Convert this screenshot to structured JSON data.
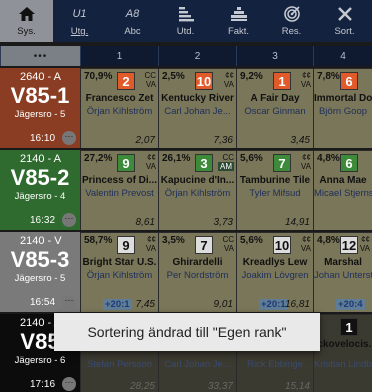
{
  "toolbar": [
    {
      "id": "sys",
      "label": "Sys.",
      "icon": "home-icon",
      "state": "active"
    },
    {
      "id": "utg",
      "label": "Utg.",
      "icon_text": "U1",
      "state": "selected"
    },
    {
      "id": "abc",
      "label": "Abc",
      "icon_text": "A8",
      "state": "normal"
    },
    {
      "id": "utd",
      "label": "Utd.",
      "icon": "bar-sort-icon",
      "state": "normal"
    },
    {
      "id": "fakt",
      "label": "Fakt.",
      "icon": "stack-bars-icon",
      "state": "normal"
    },
    {
      "id": "res",
      "label": "Res.",
      "icon": "target-icon",
      "state": "normal"
    },
    {
      "id": "sort",
      "label": "Sort.",
      "icon": "close-icon",
      "state": "normal"
    }
  ],
  "column_header": {
    "dots": "•••",
    "cols": [
      "1",
      "2",
      "3",
      "4"
    ]
  },
  "races": [
    {
      "top": "2640 - A",
      "name": "V85-1",
      "track": "Jägersro - 5",
      "time": "16:10",
      "color": "#8a3d22",
      "horses": [
        {
          "pct": "70,9%",
          "num": "2",
          "num_bg": "#e05a2a",
          "num_fg": "#fff",
          "tag1": "CC",
          "tag2": "VA",
          "name": "Francesco Zet",
          "driver": "Örjan Kihlström",
          "val": "2,07"
        },
        {
          "pct": "2,5%",
          "num": "10",
          "num_bg": "#e05a2a",
          "num_fg": "#fff",
          "tag1": "¢¢",
          "tag2": "VA",
          "name": "Kentucky River",
          "driver": "Carl Johan Je...",
          "val": "7,36"
        },
        {
          "pct": "9,2%",
          "num": "1",
          "num_bg": "#e05a2a",
          "num_fg": "#fff",
          "tag1": "¢¢",
          "tag2": "VA",
          "name": "A Fair Day",
          "driver": "Oscar Ginman",
          "val": "3,45"
        },
        {
          "pct": "7,8%",
          "num": "6",
          "num_bg": "#e05a2a",
          "num_fg": "#fff",
          "tag1": "",
          "tag2": "",
          "name": "Immortal Do",
          "driver": "Björn Goop",
          "val": ""
        }
      ]
    },
    {
      "top": "2140 - A",
      "name": "V85-2",
      "track": "Jägersro - 4",
      "time": "16:32",
      "color": "#2f6b2e",
      "horses": [
        {
          "pct": "27,2%",
          "num": "9",
          "num_bg": "#3d8a3a",
          "num_fg": "#fff",
          "tag1": "¢¢",
          "tag2": "VA",
          "name": "Princess of Di...",
          "driver": "Valentin Prevost",
          "val": "8,61"
        },
        {
          "pct": "26,1%",
          "num": "3",
          "num_bg": "#3d8a3a",
          "num_fg": "#fff",
          "tag1": "CC",
          "tag2": "AM",
          "name": "Kapucine d'In...",
          "driver": "Örjan Kihlström",
          "val": "3,73"
        },
        {
          "pct": "5,6%",
          "num": "7",
          "num_bg": "#3d8a3a",
          "num_fg": "#fff",
          "tag1": "¢¢",
          "tag2": "VA",
          "name": "Tamburine Tile",
          "driver": "Tyler Mifsud",
          "val": "14,91"
        },
        {
          "pct": "4,8%",
          "num": "6",
          "num_bg": "#3d8a3a",
          "num_fg": "#fff",
          "tag1": "",
          "tag2": "",
          "name": "Anna Mae",
          "driver": "Micael Stjernst",
          "val": ""
        }
      ]
    },
    {
      "top": "2140 - V",
      "name": "V85-3",
      "track": "Jägersro - 5",
      "time": "16:54",
      "color": "#7a7a7a",
      "horses": [
        {
          "pct": "58,7%",
          "num": "9",
          "num_bg": "#ddd",
          "num_fg": "#111",
          "tag1": "¢¢",
          "tag2": "VA",
          "name": "Bright Star U.S.",
          "driver": "Örjan Kihlström",
          "val": "7,45",
          "bonus": "+20:1"
        },
        {
          "pct": "3,5%",
          "num": "7",
          "num_bg": "#ddd",
          "num_fg": "#111",
          "tag1": "CC",
          "tag2": "VA",
          "name": "Ghirardelli",
          "driver": "Per Nordström",
          "val": "9,01"
        },
        {
          "pct": "5,6%",
          "num": "10",
          "num_bg": "#ddd",
          "num_fg": "#111",
          "tag1": "¢¢",
          "tag2": "VA",
          "name": "Kreadlys Lew",
          "driver": "Joakim Lövgren",
          "val": "16,81",
          "bonus": "+20:1"
        },
        {
          "pct": "4,8%",
          "num": "12",
          "num_bg": "#ddd",
          "num_fg": "#111",
          "tag1": "¢¢",
          "tag2": "VA",
          "name": "Marshal",
          "driver": "Johan Untersteir",
          "val": "",
          "bonus": "+20:4"
        }
      ]
    },
    {
      "top": "2140 - A",
      "name": "V85",
      "track": "Jägersro - 6",
      "time": "17:16",
      "color": "#0c0c0c",
      "horses": [
        {
          "pct": "",
          "num": "",
          "num_bg": "",
          "num_fg": "",
          "tag1": "",
          "tag2": "",
          "name": "",
          "driver": "Stefan Persson",
          "val": "28,25"
        },
        {
          "pct": "",
          "num": "",
          "num_bg": "",
          "num_fg": "",
          "tag1": "",
          "tag2": "",
          "name": "",
          "driver": "Carl Johan Je...",
          "val": "33,37"
        },
        {
          "pct": "",
          "num": "",
          "num_bg": "",
          "num_fg": "",
          "tag1": "",
          "tag2": "",
          "name": "",
          "driver": "Rick Ebbinge",
          "val": "15,14"
        },
        {
          "pct": "",
          "num": "1",
          "num_bg": "#111",
          "num_fg": "#fff",
          "tag1": "",
          "tag2": "",
          "name": "ickovelocis.",
          "driver": "Kristian Lindbe",
          "val": ""
        }
      ]
    }
  ],
  "toast": "Sortering ändrad till \"Egen rank\""
}
